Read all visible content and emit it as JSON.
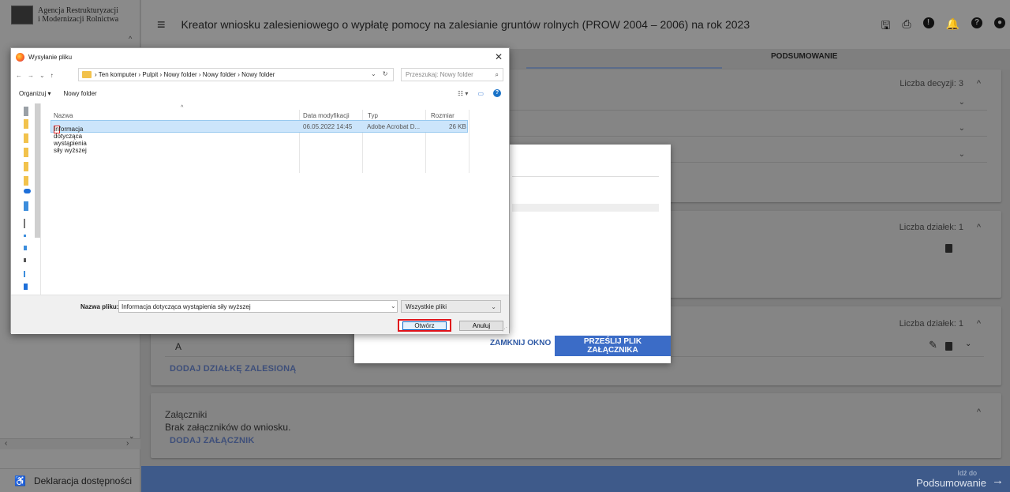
{
  "app": {
    "logo_line1": "Agencja Restrukturyzacji",
    "logo_line2": "i Modernizacji Rolnictwa",
    "title": "Kreator wniosku zalesieniowego o wypłatę pomocy na zalesianie gruntów rolnych (PROW 2004 – 2006) na rok 2023",
    "tab_summary": "PODSUMOWANIE",
    "accessibility": "Deklaracja dostępności",
    "decisions_count": "Liczba decyzji: 3",
    "plots_count_1": "Liczba działek: 1",
    "plots_count_2": "Liczba działek: 1",
    "plot_row_label": "A",
    "add_forested_plot": "DODAJ DZIAŁKĘ ZALESIONĄ",
    "attachments_title": "Załączniki",
    "attachments_empty": "Brak załączników do wniosku.",
    "add_attachment": "DODAJ ZAŁĄCZNIK",
    "goto_label": "Idź do",
    "goto_target": "Podsumowanie"
  },
  "modal": {
    "close_label": "ZAMKNIJ OKNO",
    "upload_label": "PRZEŚLIJ PLIK ZAŁĄCZNIKA"
  },
  "dialog": {
    "title": "Wysyłanie pliku",
    "breadcrumb": "› Ten komputer › Pulpit › Nowy folder › Nowy folder › Nowy folder",
    "search_placeholder": "Przeszukaj: Nowy folder",
    "organize": "Organizuj ▾",
    "new_folder": "Nowy folder",
    "columns": {
      "name": "Nazwa",
      "modified": "Data modyfikacji",
      "type": "Typ",
      "size": "Rozmiar"
    },
    "file": {
      "name": "Informacja dotycząca wystąpienia siły wyższej",
      "modified": "06.05.2022 14:45",
      "type": "Adobe Acrobat D...",
      "size": "26 KB"
    },
    "filename_label": "Nazwa pliku:",
    "filename_value": "Informacja dotycząca wystąpienia siły wyższej",
    "filter_label": "Wszystkie pliki",
    "open_label": "Otwórz",
    "cancel_label": "Anuluj"
  }
}
